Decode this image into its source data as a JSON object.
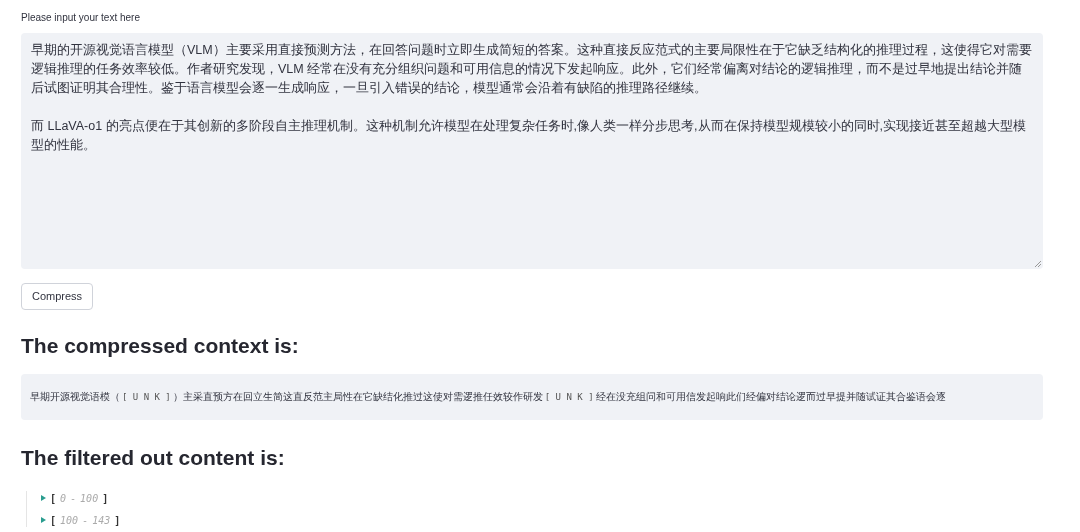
{
  "input": {
    "label": "Please input your text here",
    "paragraphs": [
      "早期的开源视觉语言模型（VLM）主要采用直接预测方法，在回答问题时立即生成简短的答案。这种直接反应范式的主要局限性在于它缺乏结构化的推理过程，这使得它对需要逻辑推理的任务效率较低。作者研究发现，VLM 经常在没有充分组织问题和可用信息的情况下发起响应。此外，它们经常偏离对结论的逻辑推理，而不是过早地提出结论并随后试图证明其合理性。鉴于语言模型会逐一生成响应，一旦引入错误的结论，模型通常会沿着有缺陷的推理路径继续。",
      "而 LLaVA-o1 的亮点便在于其创新的多阶段自主推理机制。这种机制允许模型在处理复杂任务时,像人类一样分步思考,从而在保持模型规模较小的同时,实现接近甚至超越大型模型的性能。"
    ]
  },
  "button": "Compress",
  "compressed": {
    "heading": "The compressed context is:",
    "segments": [
      {
        "kind": "text",
        "text": "早期开源视觉语模（"
      },
      {
        "kind": "token",
        "text": "[ U N K ]"
      },
      {
        "kind": "text",
        "text": "）主采直预方在回立生简这直反范主局性在它缺结化推过这使对需逻推任效较作研发"
      },
      {
        "kind": "token",
        "text": "[ U N K ]"
      },
      {
        "kind": "text",
        "text": "经在没充组问和可用信发起响此们经偏对结论逻而过早提并随试证其合鉴语会逐"
      }
    ]
  },
  "filtered": {
    "heading": "The filtered out content is:",
    "items": [
      {
        "open": "[",
        "start": "0",
        "dash": "-",
        "end": "100",
        "close": "]",
        "expanded": false
      },
      {
        "open": "[",
        "start": "100",
        "dash": "-",
        "end": "143",
        "close": "]",
        "expanded": false
      }
    ]
  }
}
